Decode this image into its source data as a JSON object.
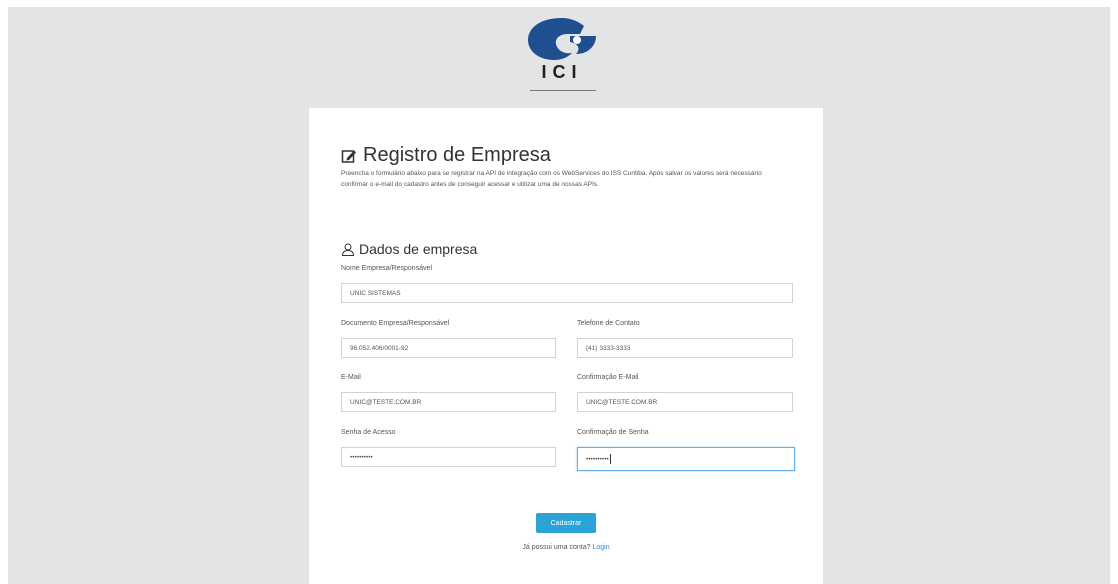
{
  "logo": {
    "text": "ICI"
  },
  "form": {
    "title": "Registro de Empresa",
    "description": "Preencha o formulário abaixo para se registrar na API de integração com os WebServices do ISS Curitiba. Após salvar os valores será necessário confirmar o e-mail do cadastro antes de conseguir acessar e utilizar uma de nossas APIs.",
    "section_title": "Dados de empresa",
    "fields": {
      "nome": {
        "label": "Nome Empresa/Responsável",
        "value": "UNIC SISTEMAS"
      },
      "documento": {
        "label": "Documento Empresa/Responsável",
        "value": "96.052.406/0001-92"
      },
      "telefone": {
        "label": "Telefone de Contato",
        "value": "(41) 3333-3333"
      },
      "email": {
        "label": "E-Mail",
        "value": "UNIC@TESTE.COM.BR"
      },
      "email_confirm": {
        "label": "Confirmação E-Mail",
        "value": "UNIC@TESTE.COM.BR"
      },
      "senha": {
        "label": "Senha de Acesso",
        "value": "••••••••••"
      },
      "senha_confirm": {
        "label": "Confirmação de Senha",
        "value": "••••••••••"
      }
    },
    "submit_label": "Cadastrar",
    "footer_text": "Já possui uma conta?",
    "login_link": "Login"
  },
  "colors": {
    "primary": "#2aa3d6",
    "logo": "#1f4f8f",
    "page_bg": "#e3e4e6"
  }
}
